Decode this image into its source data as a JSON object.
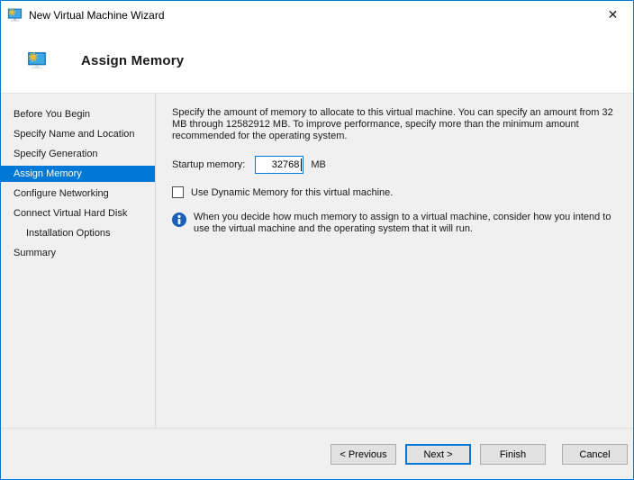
{
  "window": {
    "title": "New Virtual Machine Wizard"
  },
  "icons": {
    "app": "vm-monitor-with-gear",
    "close": "✕",
    "info": "info-circle"
  },
  "header": {
    "title": "Assign Memory"
  },
  "sidebar": {
    "items": [
      {
        "label": "Before You Begin",
        "selected": false,
        "indent": false
      },
      {
        "label": "Specify Name and Location",
        "selected": false,
        "indent": false
      },
      {
        "label": "Specify Generation",
        "selected": false,
        "indent": false
      },
      {
        "label": "Assign Memory",
        "selected": true,
        "indent": false
      },
      {
        "label": "Configure Networking",
        "selected": false,
        "indent": false
      },
      {
        "label": "Connect Virtual Hard Disk",
        "selected": false,
        "indent": false
      },
      {
        "label": "Installation Options",
        "selected": false,
        "indent": true
      },
      {
        "label": "Summary",
        "selected": false,
        "indent": false
      }
    ]
  },
  "content": {
    "description": "Specify the amount of memory to allocate to this virtual machine. You can specify an amount from 32 MB through 12582912 MB. To improve performance, specify more than the minimum amount recommended for the operating system.",
    "startup_memory": {
      "label": "Startup memory:",
      "value": "32768",
      "unit": "MB"
    },
    "dynamic_memory_checkbox": {
      "label": "Use Dynamic Memory for this virtual machine.",
      "checked": false
    },
    "info_note": "When you decide how much memory to assign to a virtual machine, consider how you intend to use the virtual machine and the operating system that it will run."
  },
  "footer": {
    "buttons": [
      {
        "label": "< Previous",
        "default": false
      },
      {
        "label": "Next >",
        "default": true
      },
      {
        "label": "Finish",
        "default": false
      },
      {
        "label": "Cancel",
        "default": false
      }
    ]
  },
  "colors": {
    "accent": "#0078d7",
    "selection_bg": "#0078d7",
    "selection_text": "#ffffff",
    "window_border": "#0078d7",
    "content_bg": "#f0f0f0",
    "header_bg": "#ffffff",
    "button_bg": "#e1e1e1",
    "button_border": "#adadad",
    "info_icon_blue": "#1a5fb8",
    "monitor_icon_blue": "#3fa9e6",
    "gear_yellow": "#f0c53a"
  }
}
